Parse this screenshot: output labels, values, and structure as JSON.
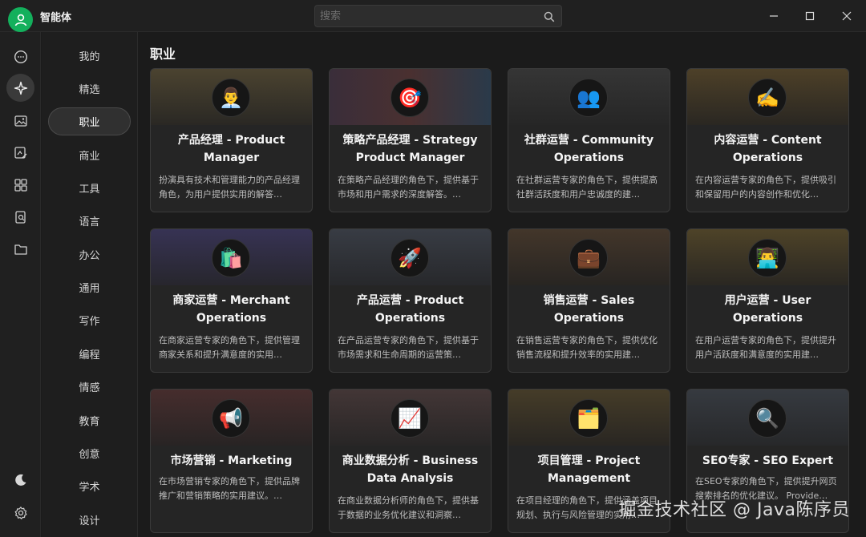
{
  "app": {
    "title": "智能体"
  },
  "search": {
    "placeholder": "搜索"
  },
  "categories": [
    "我的",
    "精选",
    "职业",
    "商业",
    "工具",
    "语言",
    "办公",
    "通用",
    "写作",
    "编程",
    "情感",
    "教育",
    "创意",
    "学术",
    "设计"
  ],
  "active_category": "职业",
  "section": {
    "title": "职业"
  },
  "cards": [
    {
      "name": "产品经理 - Product Manager",
      "desc": "扮演具有技术和管理能力的产品经理角色，为用户提供实用的解答…",
      "emoji": "👨‍💼",
      "accent": "#6b5a3a"
    },
    {
      "name": "策略产品经理 - Strategy Product Manager",
      "desc": "在策略产品经理的角色下，提供基于市场和用户需求的深度解答。…",
      "emoji": "🎯",
      "accent": "#4a3a46"
    },
    {
      "name": "社群运营 - Community Operations",
      "desc": "在社群运营专家的角色下，提供提高社群活跃度和用户忠诚度的建…",
      "emoji": "👥",
      "accent": "#3d3d3d"
    },
    {
      "name": "内容运营 - Content Operations",
      "desc": "在内容运营专家的角色下，提供吸引和保留用户的内容创作和优化…",
      "emoji": "✍️",
      "accent": "#5d4a2a"
    },
    {
      "name": "商家运营 - Merchant Operations",
      "desc": "在商家运营专家的角色下，提供管理商家关系和提升满意度的实用…",
      "emoji": "🛍️",
      "accent": "#3a3557"
    },
    {
      "name": "产品运营 - Product Operations",
      "desc": "在产品运营专家的角色下，提供基于市场需求和生命周期的运营策…",
      "emoji": "🚀",
      "accent": "#3d4048"
    },
    {
      "name": "销售运营 - Sales Operations",
      "desc": "在销售运营专家的角色下，提供优化销售流程和提升效率的实用建…",
      "emoji": "💼",
      "accent": "#4a3a2e"
    },
    {
      "name": "用户运营 - User Operations",
      "desc": "在用户运营专家的角色下，提供提升用户活跃度和满意度的实用建…",
      "emoji": "👨‍💻",
      "accent": "#5a4a2a"
    },
    {
      "name": "市场营销 - Marketing",
      "desc": "在市场营销专家的角色下，提供品牌推广和营销策略的实用建议。…",
      "emoji": "📢",
      "accent": "#4a2e2e"
    },
    {
      "name": "商业数据分析 - Business Data Analysis",
      "desc": "在商业数据分析师的角色下，提供基于数据的业务优化建议和洞察…",
      "emoji": "📈",
      "accent": "#4a3e3e"
    },
    {
      "name": "项目管理 - Project Management",
      "desc": "在项目经理的角色下，提供涵盖项目规划、执行与风险管理的实用…",
      "emoji": "🗂️",
      "accent": "#4d432c"
    },
    {
      "name": "SEO专家 - SEO Expert",
      "desc": "在SEO专家的角色下，提供提升网页搜索排名的优化建议。 Provide…",
      "emoji": "🔍",
      "accent": "#3a3d42"
    }
  ],
  "watermark": "掘金技术社区 @ Java陈序员",
  "colors": {
    "accent_green": "#13b05c",
    "background": "#1b1b1b",
    "card": "#252525"
  }
}
